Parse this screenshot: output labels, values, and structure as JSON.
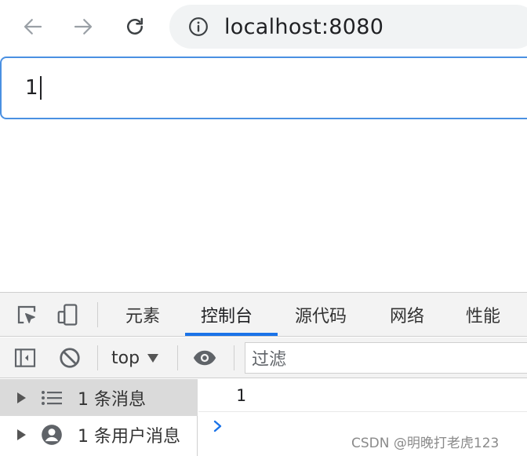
{
  "browser": {
    "url": "localhost:8080",
    "nav_icons": [
      "back-arrow-icon",
      "forward-arrow-icon",
      "reload-icon",
      "info-icon"
    ]
  },
  "page": {
    "input_value": "1"
  },
  "devtools": {
    "tabs": [
      {
        "label": "元素",
        "active": false
      },
      {
        "label": "控制台",
        "active": true
      },
      {
        "label": "源代码",
        "active": false
      },
      {
        "label": "网络",
        "active": false
      },
      {
        "label": "性能",
        "active": false
      }
    ],
    "toolbar": {
      "context": "top",
      "filter_placeholder": "过滤"
    },
    "sidebar": [
      {
        "label": "1 条消息",
        "icon": "list-icon",
        "selected": true
      },
      {
        "label": "1 条用户消息",
        "icon": "user-icon",
        "selected": false
      }
    ],
    "console_output": [
      "1"
    ],
    "accent_color": "#1a73e8"
  },
  "watermark": "CSDN @明晚打老虎123"
}
